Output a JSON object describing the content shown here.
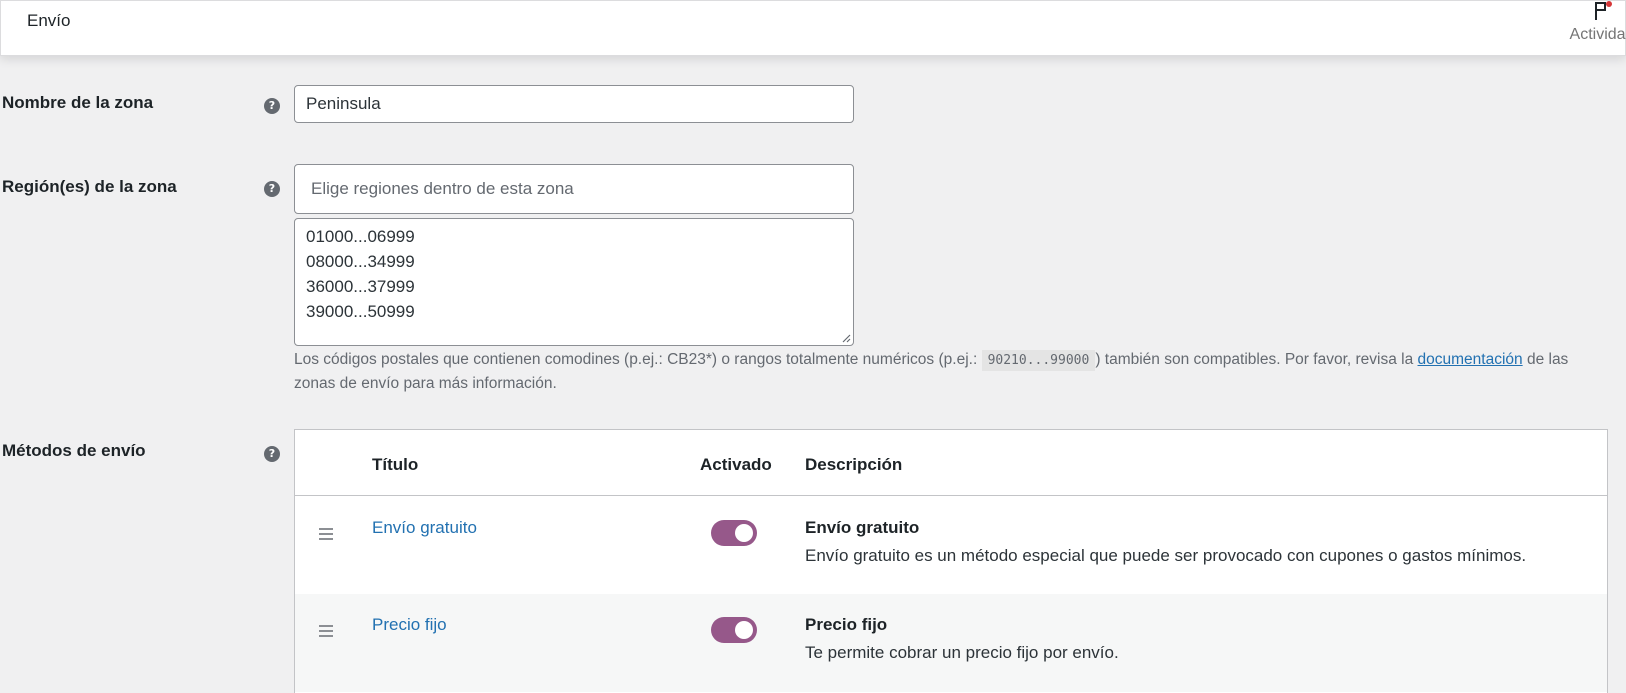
{
  "header": {
    "title": "Envío",
    "activity_label": "Actividad"
  },
  "zone_name": {
    "label": "Nombre de la zona",
    "value": "Peninsula"
  },
  "zone_regions": {
    "label": "Región(es) de la zona",
    "placeholder": "Elige regiones dentro de esta zona",
    "postcodes": [
      "01000...06999",
      "08000...34999",
      "36000...37999",
      "39000...50999"
    ],
    "help_before": "Los códigos postales que contienen comodines (p.ej.: CB23*) o rangos totalmente numéricos (p.ej.: ",
    "help_code": "90210...99000",
    "help_middle": ") también son compatibles. Por favor, revisa la ",
    "help_link": "documentación",
    "help_after": " de las zonas de envío para más información."
  },
  "shipping_methods": {
    "label": "Métodos de envío",
    "columns": {
      "title": "Título",
      "enabled": "Activado",
      "description": "Descripción"
    },
    "rows": [
      {
        "title": "Envío gratuito",
        "enabled": true,
        "desc_title": "Envío gratuito",
        "desc": "Envío gratuito es un método especial que puede ser provocado con cupones o gastos mínimos."
      },
      {
        "title": "Precio fijo",
        "enabled": true,
        "desc_title": "Precio fijo",
        "desc": "Te permite cobrar un precio fijo por envío."
      }
    ]
  },
  "colors": {
    "accent": "#96588a",
    "link": "#2271b1"
  }
}
